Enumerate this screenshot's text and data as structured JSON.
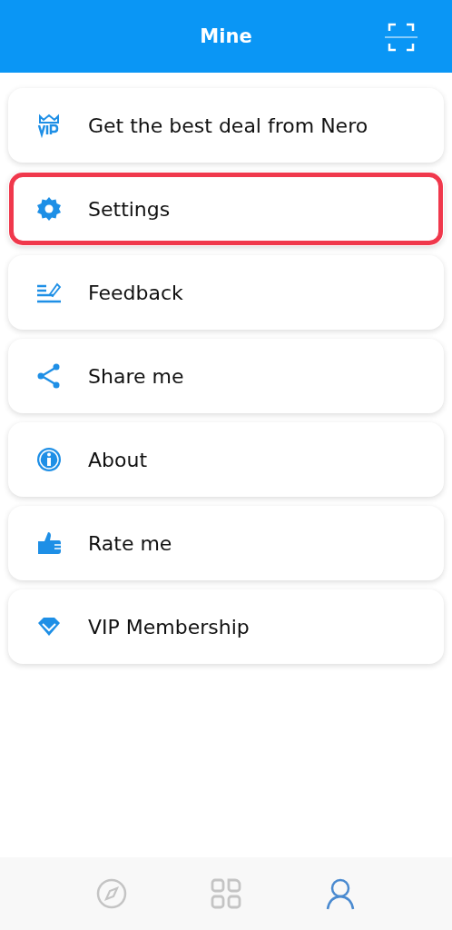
{
  "header": {
    "title": "Mine"
  },
  "menu": [
    {
      "kind": "vip",
      "label": "Get the best deal from Nero",
      "highlighted": false
    },
    {
      "kind": "settings",
      "label": "Settings",
      "highlighted": true
    },
    {
      "kind": "feedback",
      "label": "Feedback",
      "highlighted": false
    },
    {
      "kind": "share",
      "label": "Share me",
      "highlighted": false
    },
    {
      "kind": "about",
      "label": "About",
      "highlighted": false
    },
    {
      "kind": "rate",
      "label": "Rate me",
      "highlighted": false
    },
    {
      "kind": "diamond",
      "label": "VIP Membership",
      "highlighted": false
    }
  ],
  "bottom_nav": [
    {
      "kind": "explore",
      "selected": false
    },
    {
      "kind": "apps",
      "selected": false
    },
    {
      "kind": "profile",
      "selected": true
    }
  ]
}
